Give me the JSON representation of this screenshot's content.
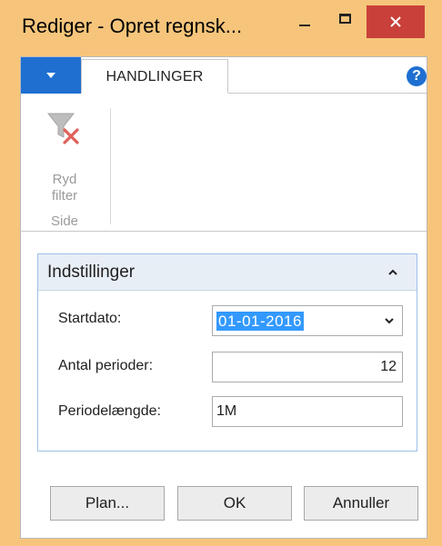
{
  "window": {
    "title": "Rediger - Opret regnsk..."
  },
  "ribbon": {
    "tab_label": "HANDLINGER",
    "help_glyph": "?",
    "actions": [
      {
        "label_line1": "Ryd",
        "label_line2": "filter",
        "icon": "clear-filter-icon"
      }
    ],
    "group_label": "Side"
  },
  "fasttab": {
    "title": "Indstillinger",
    "fields": [
      {
        "label": "Startdato:",
        "value": "01-01-2016"
      },
      {
        "label": "Antal perioder:",
        "value": "12"
      },
      {
        "label": "Periodelængde:",
        "value": "1M"
      }
    ]
  },
  "buttons": {
    "plan": "Plan...",
    "ok": "OK",
    "cancel": "Annuller"
  },
  "colors": {
    "title_bar": "#f6c57b",
    "close_button": "#c9403b",
    "accent_blue": "#1f6fd1",
    "selection": "#3399ff"
  }
}
